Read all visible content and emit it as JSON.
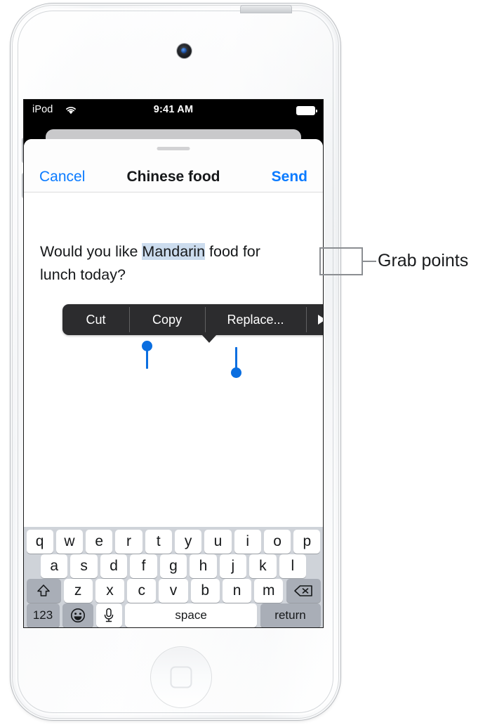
{
  "status_bar": {
    "carrier": "iPod",
    "wifi_icon": "wifi-icon",
    "time": "9:41 AM",
    "battery_icon": "battery-full-icon"
  },
  "nav_bar": {
    "cancel_label": "Cancel",
    "title": "Chinese food",
    "send_label": "Send"
  },
  "edit_menu": {
    "items": [
      {
        "label": "Cut",
        "name": "cut"
      },
      {
        "label": "Copy",
        "name": "copy"
      },
      {
        "label": "Replace...",
        "name": "replace"
      }
    ],
    "more_icon": "triangle-right-icon",
    "background_color": "#2c2c2e"
  },
  "message": {
    "text_before": "Would you like ",
    "selected_text": "Mandarin",
    "text_after": " food for\nlunch today?",
    "full_text": "Would you like Mandarin food for lunch today?",
    "selection_highlight_color": "#ccdcee",
    "grab_point_color": "#0a6ee0"
  },
  "annotation": {
    "label": "Grab points",
    "line_color": "#8b8e92"
  },
  "keyboard": {
    "row1": [
      "q",
      "w",
      "e",
      "r",
      "t",
      "y",
      "u",
      "i",
      "o",
      "p"
    ],
    "row2": [
      "a",
      "s",
      "d",
      "f",
      "g",
      "h",
      "j",
      "k",
      "l"
    ],
    "row3_shift_icon": "shift-up-arrow-icon",
    "row3": [
      "z",
      "x",
      "c",
      "v",
      "b",
      "n",
      "m"
    ],
    "row3_delete_icon": "backspace-delete-icon",
    "row4": {
      "numbers_label": "123",
      "emoji_icon": "smiley-face-icon",
      "dictation_icon": "microphone-icon",
      "space_label": "space",
      "return_label": "return"
    },
    "background_color": "#cfd3d9"
  },
  "device": {
    "camera": "front-camera",
    "home_button": "home-button",
    "power_button": "power-button",
    "volume_up": "volume-up-button",
    "volume_down": "volume-down-button"
  }
}
